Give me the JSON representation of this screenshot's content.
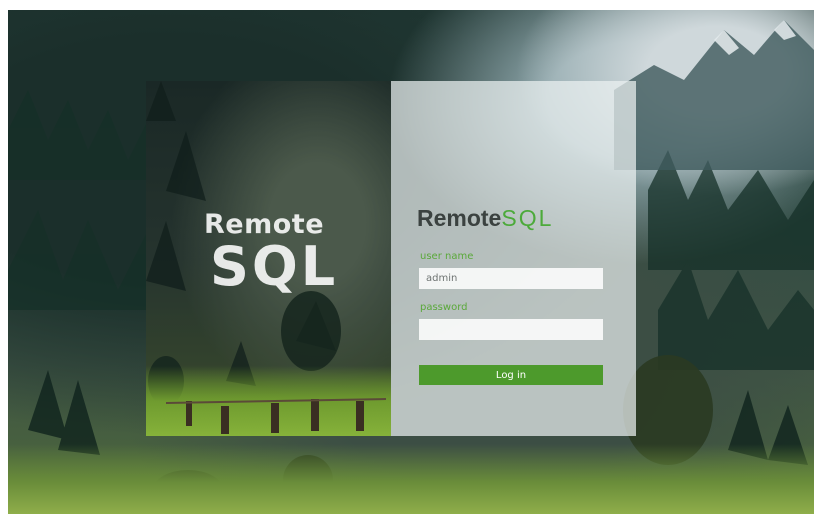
{
  "hero": {
    "line1": "Remote",
    "line2": "SQL"
  },
  "brand": {
    "part1": "Remote",
    "part2": "SQL"
  },
  "form": {
    "username_label": "user name",
    "username_value": "admin",
    "password_label": "password",
    "password_value": "",
    "login_label": "Log in"
  },
  "colors": {
    "accent": "#4d9a2c",
    "brand_green": "#4caa3a",
    "brand_dark": "#3b4240",
    "label_green": "#5aa83a"
  }
}
